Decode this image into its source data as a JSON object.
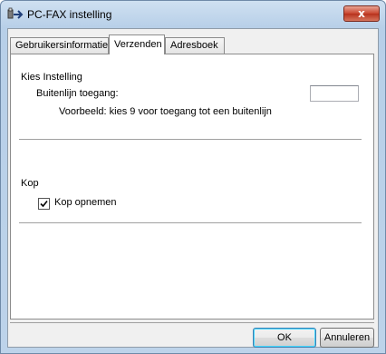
{
  "window": {
    "title": "PC-FAX instelling",
    "close_label": "x"
  },
  "tabs": [
    {
      "label": "Gebruikersinformatie",
      "active": false
    },
    {
      "label": "Verzenden",
      "active": true
    },
    {
      "label": "Adresboek",
      "active": false
    }
  ],
  "dial_settings": {
    "heading": "Kies Instelling",
    "outside_line_label": "Buitenlijn toegang:",
    "outside_line_value": "",
    "example_text": "Voorbeeld: kies 9 voor toegang tot een buitenlijn"
  },
  "header_section": {
    "heading": "Kop",
    "include_header_label": "Kop opnemen",
    "include_header_checked": true
  },
  "buttons": {
    "ok": "OK",
    "cancel": "Annuleren"
  },
  "colors": {
    "title_bar": "#bdd3ea",
    "close_button": "#c9452f",
    "panel_background": "#ffffff",
    "dialog_background": "#f0f0f0"
  },
  "icons": {
    "app": "pc-fax-app-icon",
    "close": "close-icon",
    "check": "checkmark-icon"
  }
}
